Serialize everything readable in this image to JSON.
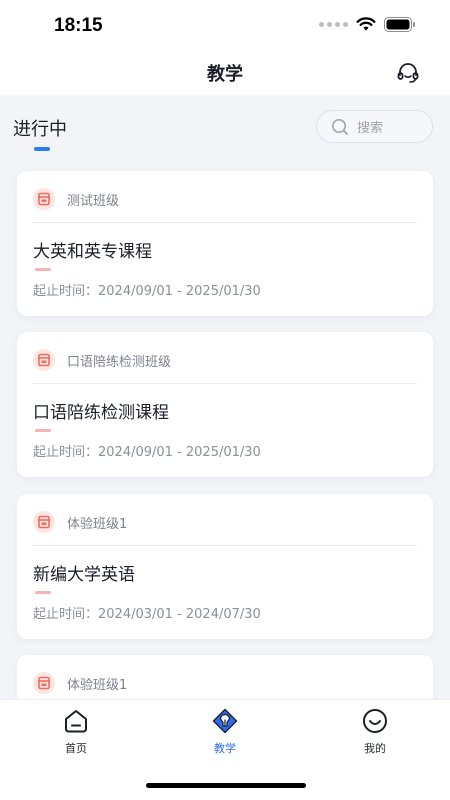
{
  "status_bar": {
    "time": "18:15"
  },
  "header": {
    "title": "教学",
    "support_icon": "headset-icon"
  },
  "filter": {
    "active_tab": "进行中",
    "search_placeholder": "搜索",
    "accent_color": "#2d7bf0"
  },
  "courses": [
    {
      "class_name": "测试班级",
      "title": "大英和英专课程",
      "dates": "起止时间：2024/09/01 - 2025/01/30"
    },
    {
      "class_name": "口语陪练检测班级",
      "title": "口语陪练检测课程",
      "dates": "起止时间：2024/09/01 - 2025/01/30"
    },
    {
      "class_name": "体验班级1",
      "title": "新编大学英语",
      "dates": "起止时间：2024/03/01 - 2024/07/30"
    },
    {
      "class_name": "体验班级1",
      "title": "",
      "dates": ""
    }
  ],
  "tab_bar": {
    "items": [
      {
        "label": "首页",
        "icon": "home-icon",
        "active": false
      },
      {
        "label": "教学",
        "icon": "teaching-icon",
        "active": true
      },
      {
        "label": "我的",
        "icon": "profile-smile-icon",
        "active": false
      }
    ],
    "active_color": "#2d6cf0"
  },
  "class_icon_color": "#f26b5e"
}
